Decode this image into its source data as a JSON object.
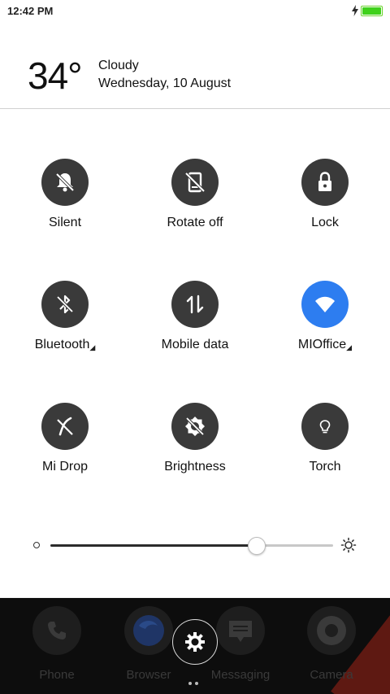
{
  "status_bar": {
    "time": "12:42 PM",
    "battery_level": 1.0
  },
  "weather": {
    "temperature": "34°",
    "condition": "Cloudy",
    "date": "Wednesday, 10 August"
  },
  "toggles": [
    {
      "label": "Silent",
      "icon": "silent-bell-icon",
      "active": false
    },
    {
      "label": "Rotate off",
      "icon": "rotate-lock-icon",
      "active": false
    },
    {
      "label": "Lock",
      "icon": "lock-icon",
      "active": false
    },
    {
      "label": "Bluetooth",
      "icon": "bluetooth-off-icon",
      "active": false,
      "has_menu": true
    },
    {
      "label": "Mobile data",
      "icon": "mobile-data-icon",
      "active": false
    },
    {
      "label": "MIOffice",
      "icon": "wifi-icon",
      "active": true,
      "has_menu": true
    },
    {
      "label": "Mi Drop",
      "icon": "mi-drop-icon",
      "active": false
    },
    {
      "label": "Brightness",
      "icon": "auto-brightness-icon",
      "active": false
    },
    {
      "label": "Torch",
      "icon": "torch-icon",
      "active": false
    }
  ],
  "brightness": {
    "level": 0.73
  },
  "dock": {
    "apps": [
      {
        "label": "Phone",
        "icon": "phone-icon"
      },
      {
        "label": "Browser",
        "icon": "browser-icon"
      },
      {
        "label": "Messaging",
        "icon": "messaging-icon"
      },
      {
        "label": "Camera",
        "icon": "camera-icon"
      }
    ]
  },
  "colors": {
    "active_toggle": "#2d7df0",
    "inactive_toggle": "#3a3a3a",
    "battery": "#3fd11b"
  }
}
